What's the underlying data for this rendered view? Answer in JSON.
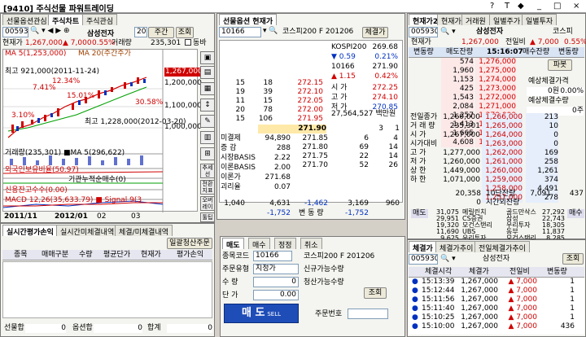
{
  "window": {
    "title": "[9410] 주식선물 파워트레이딩",
    "controls": [
      "?",
      "T",
      "◆",
      "_",
      "□",
      "×"
    ]
  },
  "left": {
    "tabs": [
      "선물옵션관심",
      "주식차트",
      "주식관심"
    ],
    "code": "005930",
    "name": "삼성전자",
    "period": "20",
    "period_unit": "주간",
    "query": "조회",
    "price_label": "현재가",
    "price": "1,267,000",
    "change": "▲ 7,000",
    "rate": "0.55%",
    "vol_label": "거래량",
    "volume": "235,301",
    "chk_label": "동바",
    "ma5": "MA 5(1,253,000)",
    "ma20": "MA 20(주간주가",
    "high": "최고 921,000(2011-11-24)",
    "pct1": "12.34%",
    "pct2": "7.41%",
    "pct3": "15.01%",
    "pct4": "3.10%",
    "pct5": "30.58%",
    "low": "최고 1,228,000(2012-03-20)",
    "y_labels": [
      "1,267,000",
      "1,200,000",
      "1,100,000",
      "1,000,000"
    ],
    "vol_ind": "거래량(235,301) ■MA 5(296,622)",
    "foreign": "외국인보유비율(50.97)",
    "inst": "기관누적순매수(0)",
    "credit": "신용잔고수수(0.00)",
    "macd": "MACD 12,26(35,633.79) ■ Signal 9(3",
    "dates": [
      "2011/11",
      "2012/01",
      "02",
      "03"
    ],
    "side_buttons": [
      "추세선",
      "전환지표",
      "오버레이",
      "툴팁"
    ],
    "eval_tabs": [
      "실시간평가손익",
      "실시간미체결내역",
      "체결/미체결내역"
    ],
    "eval_btn": "일괄청산주문",
    "eval_cols": [
      "종목",
      "매매구분",
      "수량",
      "평균단가",
      "현재가",
      "평가손익"
    ],
    "totals": [
      {
        "label": "선물합",
        "val": "0"
      },
      {
        "label": "옵션합",
        "val": "0"
      },
      {
        "label": "합계",
        "val": "0"
      }
    ]
  },
  "mid": {
    "title": "선물옵션 현재가",
    "code": "10166",
    "name": "코스피200 F 201206",
    "btn": "체결가",
    "kospi_label": "KOSPI200",
    "kospi": "269.68",
    "kospi_chg": "▼ 0.59",
    "kospi_rate": "0.21%",
    "fut_code": "10166",
    "fut": "271.90",
    "fut_chg": "▲ 1.15",
    "fut_rate": "0.42%",
    "open_l": "시 가",
    "open": "272.25",
    "hi_l": "고 가",
    "hi": "274.10",
    "lo_l": "저 가",
    "lo": "270.85",
    "vol_l": "",
    "vol": "27,564,527 백만원",
    "ask": [
      {
        "c": "15",
        "q": "18",
        "p": "272.15"
      },
      {
        "c": "19",
        "q": "39",
        "p": "272.10"
      },
      {
        "c": "11",
        "q": "15",
        "p": "272.05"
      },
      {
        "c": "20",
        "q": "78",
        "p": "272.00"
      },
      {
        "c": "15",
        "q": "106",
        "p": "271.95"
      }
    ],
    "cur": "271.90",
    "cur_r": "3",
    "cur_r2": "1",
    "info": [
      {
        "l": "미결제",
        "v": "94,890"
      },
      {
        "l": "증 감",
        "v": "288"
      },
      {
        "l": "시장BASIS",
        "v": "2.22"
      },
      {
        "l": "이론BASIS",
        "v": "2.00"
      },
      {
        "l": "이론가",
        "v": "271.68"
      },
      {
        "l": "괴리율",
        "v": "0.07"
      }
    ],
    "bid": [
      {
        "p": "271.85",
        "q": "6",
        "c": "4"
      },
      {
        "p": "271.80",
        "q": "69",
        "c": "14"
      },
      {
        "p": "271.75",
        "q": "22",
        "c": "14"
      },
      {
        "p": "271.70",
        "q": "52",
        "c": "26"
      }
    ],
    "tot_ask_c": "1,040",
    "tot_ask": "4,631",
    "tot_diff": "-1,462",
    "tot_bid": "3,169",
    "tot_bid_c": "960",
    "sum_l": "-1,752",
    "sum_mid": "변 동 량",
    "sum_r": "-1,752",
    "order_tabs": [
      "매도",
      "매수",
      "정정",
      "취소"
    ],
    "o_code_l": "종목코드",
    "o_code": "10166",
    "o_name": "코스피200 F 201206",
    "o_type_l": "주문유형",
    "o_type": "지정가",
    "o_qty_l": "수 량",
    "o_qty": "0",
    "o_price_l": "단 가",
    "o_price": "0.00",
    "new_l": "신규가능수량",
    "clr_l": "청산가능수량",
    "query": "조회",
    "sell": "매 도",
    "sell_sub": "SELL",
    "ordno_l": "주문번호"
  },
  "right": {
    "tabs": [
      "현재가2",
      "현재가",
      "거래원",
      "일별주가",
      "일별투자"
    ],
    "code": "005930",
    "name": "삼성전자",
    "market": "코스피",
    "hdr": {
      "price_l": "현재가",
      "price": "1,267,000",
      "prev_l": "전일비",
      "chg": "▲ 7,000",
      "rate": "0.55%"
    },
    "cols": [
      "변동량",
      "매도잔량",
      "15:16:07",
      "매수잔량",
      "변동량"
    ],
    "asks": [
      {
        "q": "574",
        "p": "1,276,000"
      },
      {
        "q": "1,960",
        "p": "1,275,000"
      },
      {
        "q": "1,153",
        "p": "1,274,000"
      },
      {
        "q": "425",
        "p": "1,273,000"
      },
      {
        "q": "1,543",
        "p": "1,272,000"
      },
      {
        "q": "2,084",
        "p": "1,271,000"
      },
      {
        "q": "1,257",
        "p": "1,270,000"
      },
      {
        "q": "1,413",
        "p": "1,269,000"
      },
      {
        "q": "1,665",
        "p": "1,268,000"
      },
      {
        "q": "4,608",
        "p": "1,267,000"
      }
    ],
    "stats": [
      {
        "l": "전일종가",
        "v": "1,260,000"
      },
      {
        "l": "거 래 량",
        "v": "235,301"
      },
      {
        "l": "시 가",
        "v": "1,267,000"
      },
      {
        "l": "시가대비",
        "v": ""
      },
      {
        "l": "고 가",
        "v": "1,277,000"
      },
      {
        "l": "저 가",
        "v": "1,260,000"
      },
      {
        "l": "상 한",
        "v": "1,449,000"
      },
      {
        "l": "하 한",
        "v": "1,071,000"
      }
    ],
    "bids": [
      {
        "p": "1,266,000",
        "q": "213"
      },
      {
        "p": "1,265,000",
        "q": "10"
      },
      {
        "p": "1,264,000",
        "q": "0"
      },
      {
        "p": "1,263,000",
        "q": "0"
      },
      {
        "p": "1,262,000",
        "q": "169"
      },
      {
        "p": "1,261,000",
        "q": "258"
      },
      {
        "p": "1,260,000",
        "q": "1,261"
      },
      {
        "p": "1,259,000",
        "q": "374"
      },
      {
        "p": "1,258,000",
        "q": "4,491"
      },
      {
        "p": "1,257,000",
        "q": "278"
      }
    ],
    "tot_l": "20,358",
    "tot_mid": "10단잔량",
    "tot_r": "7,091",
    "tot_r2": "437",
    "rem_l": "0",
    "rem_mid": "시간외잔량",
    "side_labels": [
      "매도",
      "매수"
    ],
    "pie_btn": "파봇",
    "est_price_l": "예상체결가격",
    "est_price": "0원",
    "est_rate": "0.00%",
    "est_qty_l": "예상체결수량",
    "est_qty": "0주",
    "brokers": [
      {
        "s": "31,075",
        "n": "메릴린치",
        "b": "골드만삭스",
        "bq": "27,292"
      },
      {
        "s": "29,951",
        "n": "CS증권",
        "b": "삼성",
        "bq": "22,743"
      },
      {
        "s": "19,320",
        "n": "모건스탠리",
        "b": "우리투자",
        "bq": "18,305"
      },
      {
        "s": "11,690",
        "n": "UBS",
        "b": "동부",
        "bq": "11,837"
      },
      {
        "s": "9,625",
        "n": "우리투자",
        "b": "모건스탠리",
        "bq": "8,285"
      }
    ],
    "exe_tabs": [
      "체결가",
      "체결가추이",
      "전일체결가추이"
    ],
    "exe_code": "005930",
    "exe_name": "삼성전자",
    "exe_btn": "조회",
    "exe_cols": [
      "체결시각",
      "체결가",
      "전일비",
      "변동량"
    ],
    "exe_rows": [
      {
        "t": "15:13:39",
        "p": "1,267,000",
        "c": "7,000",
        "q": "1"
      },
      {
        "t": "15:12:44",
        "p": "1,267,000",
        "c": "7,000",
        "q": "1"
      },
      {
        "t": "15:11:56",
        "p": "1,267,000",
        "c": "7,000",
        "q": "1"
      },
      {
        "t": "15:11:40",
        "p": "1,267,000",
        "c": "7,000",
        "q": "1"
      },
      {
        "t": "15:10:25",
        "p": "1,267,000",
        "c": "7,000",
        "q": "1"
      },
      {
        "t": "15:10:00",
        "p": "1,267,000",
        "c": "7,000",
        "q": "436"
      }
    ]
  },
  "chart_data": {
    "type": "line",
    "dates": [
      "2011/11",
      "2012/01",
      "02",
      "03"
    ],
    "title": "",
    "ylim": [
      921000,
      1277000
    ]
  }
}
